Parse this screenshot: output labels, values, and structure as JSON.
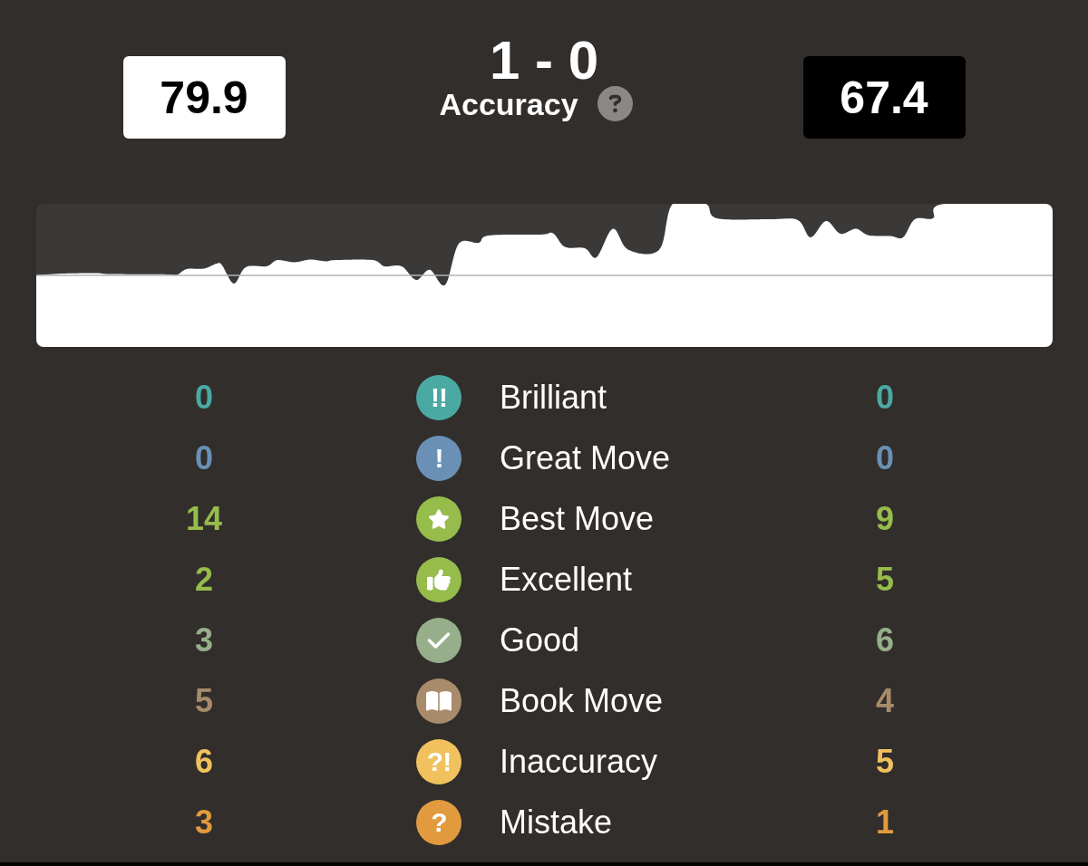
{
  "result": "1 - 0",
  "accuracy": {
    "label": "Accuracy",
    "players": [
      {
        "dark": false,
        "score": "79.9"
      },
      {
        "dark": true,
        "score": "67.4"
      }
    ]
  },
  "classifications": [
    {
      "kind": "brilliant",
      "symbol": "!!",
      "label": "Brilliant",
      "white": "0",
      "black": "0",
      "color": "#4aa9a3"
    },
    {
      "kind": "great",
      "symbol": "!",
      "label": "Great Move",
      "white": "0",
      "black": "0",
      "color": "#6a90b6"
    },
    {
      "kind": "best",
      "label": "Best Move",
      "white": "14",
      "black": "9",
      "color": "#96bc4b"
    },
    {
      "kind": "excellent",
      "label": "Excellent",
      "white": "2",
      "black": "5",
      "color": "#96bc4b"
    },
    {
      "kind": "good",
      "label": "Good",
      "white": "3",
      "black": "6",
      "color": "#97ae8b"
    },
    {
      "kind": "book",
      "label": "Book Move",
      "white": "5",
      "black": "4",
      "color": "#a88b6a"
    },
    {
      "kind": "inaccuracy",
      "symbol": "?!",
      "label": "Inaccuracy",
      "white": "6",
      "black": "5",
      "color": "#f0c15c"
    },
    {
      "kind": "mistake",
      "symbol": "?",
      "label": "Mistake",
      "white": "3",
      "black": "1",
      "color": "#e29a3f"
    }
  ]
}
